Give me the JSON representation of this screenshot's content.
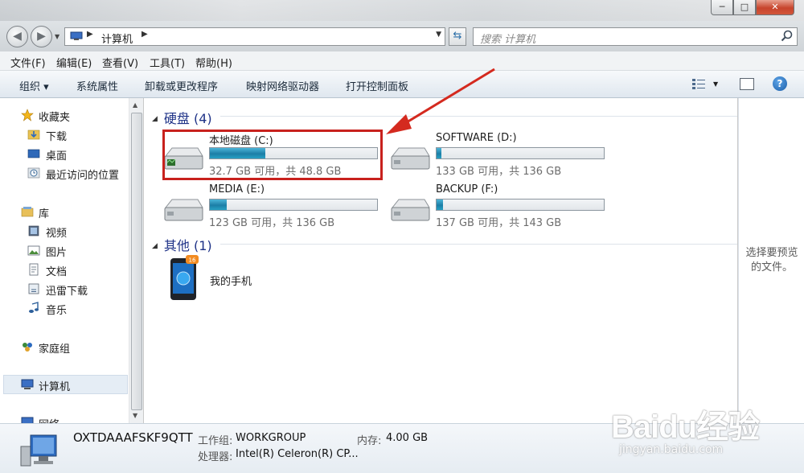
{
  "window": {
    "minimize_glyph": "─",
    "maximize_glyph": "□",
    "close_glyph": "✕"
  },
  "address_bar": {
    "breadcrumb": "计算机",
    "search_placeholder": "搜索 计算机"
  },
  "menu": {
    "items": [
      "文件(F)",
      "编辑(E)",
      "查看(V)",
      "工具(T)",
      "帮助(H)"
    ]
  },
  "toolbar": {
    "items": [
      "组织 ▾",
      "系统属性",
      "卸载或更改程序",
      "映射网络驱动器",
      "打开控制面板"
    ],
    "help": "?"
  },
  "nav_pane": {
    "favorites": "收藏夹",
    "downloads": "下载",
    "desktop": "桌面",
    "recent": "最近访问的位置",
    "libraries": "库",
    "videos": "视频",
    "pictures": "图片",
    "documents": "文档",
    "thunder": "迅雷下载",
    "music": "音乐",
    "homegroup": "家庭组",
    "computer": "计算机",
    "network": "网络"
  },
  "content": {
    "hdd_group": "硬盘 (4)",
    "other_group": "其他 (1)",
    "drives": [
      {
        "name": "本地磁盘 (C:)",
        "info": "32.7 GB 可用，共 48.8 GB",
        "used_fraction": 0.33
      },
      {
        "name": "SOFTWARE (D:)",
        "info": "133 GB 可用，共 136 GB",
        "used_fraction": 0.03
      },
      {
        "name": "MEDIA (E:)",
        "info": "123 GB 可用，共 136 GB",
        "used_fraction": 0.1
      },
      {
        "name": "BACKUP (F:)",
        "info": "137 GB 可用，共 143 GB",
        "used_fraction": 0.04
      }
    ],
    "phone": {
      "name": "我的手机",
      "badge": "16"
    }
  },
  "preview": {
    "message": "选择要预览的文件。"
  },
  "details": {
    "computer_name": "OXTDAAAFSKF9QTT",
    "workgroup_label": "工作组:",
    "workgroup_value": "WORKGROUP",
    "memory_label": "内存:",
    "memory_value": "4.00 GB",
    "processor_label": "处理器:",
    "processor_value": "Intel(R) Celeron(R) CP..."
  },
  "watermark": {
    "brand": "Baidu经验",
    "url": "jingyan.baidu.com"
  },
  "colors": {
    "highlight_box": "#c8211d",
    "group_heading": "#1e3287",
    "drive_bar_fill": "#1c7ea6"
  }
}
